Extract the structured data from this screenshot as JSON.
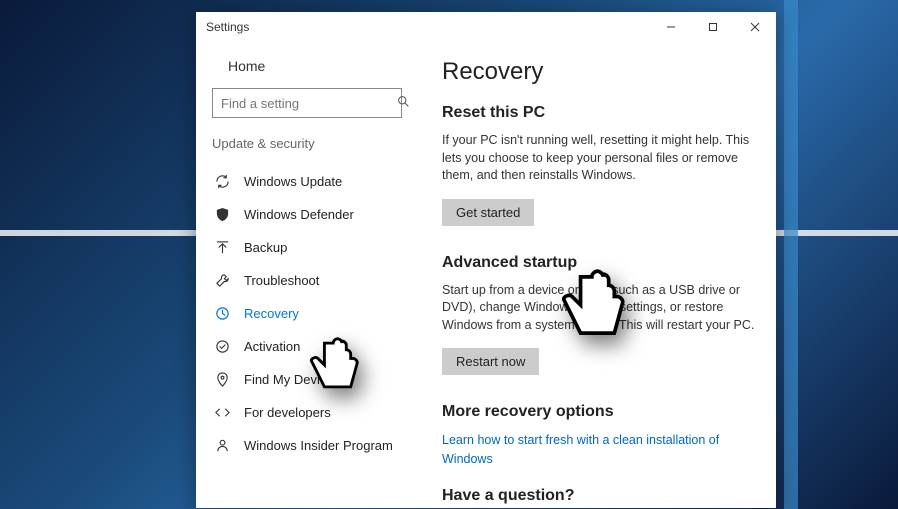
{
  "window": {
    "title": "Settings"
  },
  "sidebar": {
    "home": "Home",
    "searchPlaceholder": "Find a setting",
    "category": "Update & security",
    "items": [
      {
        "label": "Windows Update"
      },
      {
        "label": "Windows Defender"
      },
      {
        "label": "Backup"
      },
      {
        "label": "Troubleshoot"
      },
      {
        "label": "Recovery",
        "selected": true
      },
      {
        "label": "Activation"
      },
      {
        "label": "Find My Device"
      },
      {
        "label": "For developers"
      },
      {
        "label": "Windows Insider Program"
      }
    ]
  },
  "page": {
    "title": "Recovery",
    "sections": [
      {
        "title": "Reset this PC",
        "body": "If your PC isn't running well, resetting it might help. This lets you choose to keep your personal files or remove them, and then reinstalls Windows.",
        "button": "Get started"
      },
      {
        "title": "Advanced startup",
        "body": "Start up from a device or disc (such as a USB drive or DVD), change Windows startup settings, or restore Windows from a system image. This will restart your PC.",
        "button": "Restart now"
      },
      {
        "title": "More recovery options",
        "link": "Learn how to start fresh with a clean installation of Windows"
      }
    ],
    "cutoff": "Have a question?"
  }
}
